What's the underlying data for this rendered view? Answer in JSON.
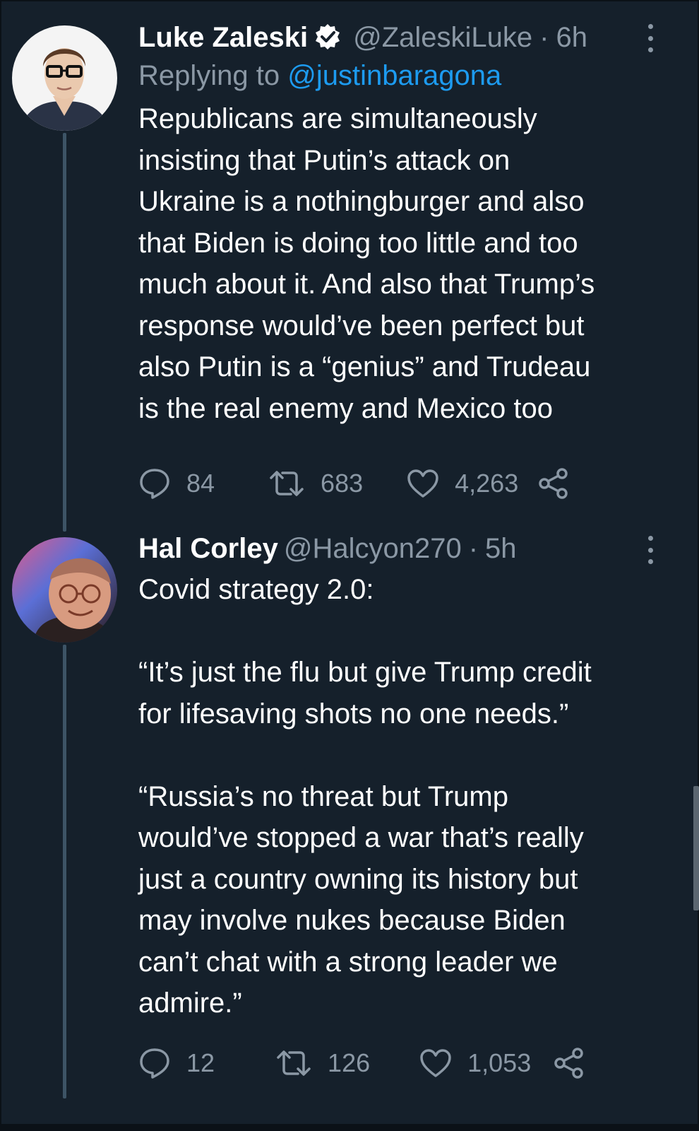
{
  "tweets": [
    {
      "display_name": "Luke Zaleski",
      "verified": true,
      "handle": "@ZaleskiLuke",
      "separator": "·",
      "time": "6h",
      "replying_prefix": "Replying to",
      "replying_to": "@justinbaragona",
      "lines": [
        "Republicans are simultaneously",
        "insisting that Putin’s attack on",
        "Ukraine is a nothingburger and also",
        "that Biden is doing too little and too",
        "much about it. And also that Trump’s",
        "response would’ve been perfect but",
        "also Putin is a “genius” and Trudeau",
        "is the real enemy and Mexico too"
      ],
      "stats": {
        "replies": "84",
        "retweets": "683",
        "likes": "4,263"
      }
    },
    {
      "display_name": "Hal Corley",
      "verified": false,
      "handle": "@Halcyon270",
      "separator": "·",
      "time": "5h",
      "lines": [
        "Covid strategy 2.0:",
        "",
        "“It’s just the flu but give Trump credit",
        "for lifesaving shots no one needs.”",
        "",
        "“Russia’s no threat but Trump",
        "would’ve stopped a war that’s really",
        "just a country owning its history but",
        "may involve nukes because Biden",
        "can’t chat with a strong leader we",
        "admire.”"
      ],
      "stats": {
        "replies": "12",
        "retweets": "126",
        "likes": "1,053"
      }
    }
  ],
  "icons": {
    "reply": "reply-icon",
    "retweet": "retweet-icon",
    "like": "heart-icon",
    "share": "share-icon",
    "verified": "verified-badge-icon",
    "more": "more-options-icon"
  },
  "colors": {
    "background": "#15202b",
    "secondary_text": "#8b98a5",
    "link": "#1d9bf0",
    "thread_line": "#3d5466"
  }
}
